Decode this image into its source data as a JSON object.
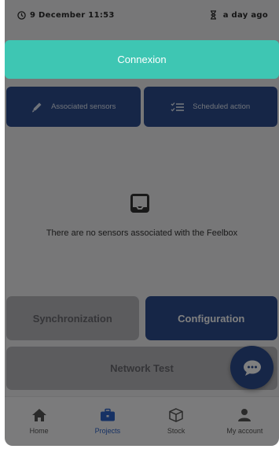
{
  "status": {
    "timestamp": "9 December 11:53",
    "relative_time": "a day ago"
  },
  "connexion": {
    "label": "Connexion"
  },
  "tabs": [
    {
      "label": "Associated sensors",
      "icon": "pen-icon"
    },
    {
      "label": "Scheduled action",
      "icon": "checklist-icon"
    }
  ],
  "empty_state": {
    "icon": "inbox-icon",
    "message": "There are no sensors associated with the Feelbox"
  },
  "actions": {
    "sync_label": "Synchronization",
    "config_label": "Configuration",
    "network_label": "Network Test"
  },
  "nav": [
    {
      "label": "Home",
      "icon": "home-icon"
    },
    {
      "label": "Projects",
      "icon": "briefcase-icon",
      "active": true
    },
    {
      "label": "Stock",
      "icon": "box-icon"
    },
    {
      "label": "My account",
      "icon": "user-icon"
    }
  ],
  "colors": {
    "teal": "#3ec6b3",
    "navy": "#2d4c8f",
    "active_nav": "#2d63c8"
  }
}
